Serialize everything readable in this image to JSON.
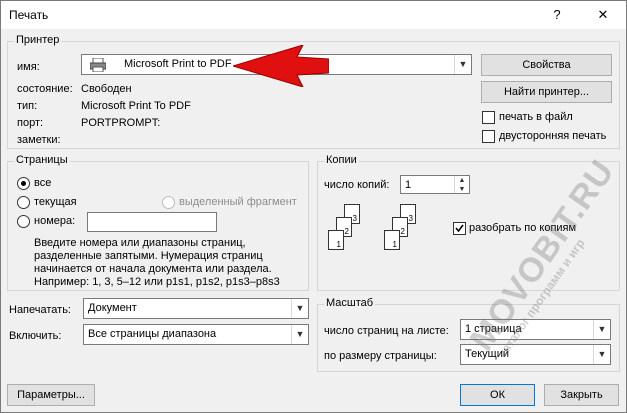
{
  "window": {
    "title": "Печать",
    "help_glyph": "?",
    "close_glyph": "✕"
  },
  "printer": {
    "legend": "Принтер",
    "name_label": "имя:",
    "name_value": "Microsoft Print to PDF",
    "status_label": "состояние:",
    "status_value": "Свободен",
    "type_label": "тип:",
    "type_value": "Microsoft Print To PDF",
    "port_label": "порт:",
    "port_value": "PORTPROMPT:",
    "notes_label": "заметки:",
    "properties_button": "Свойства",
    "find_button": "Найти принтер...",
    "print_to_file": "печать в файл",
    "duplex": "двусторонняя печать"
  },
  "pages": {
    "legend": "Страницы",
    "all": "все",
    "current": "текущая",
    "selection": "выделенный фрагмент",
    "numbers": "номера:",
    "numbers_value": "",
    "hint": [
      "Введите номера или диапазоны страниц,",
      "разделенные запятыми. Нумерация страниц",
      "начинается от начала документа или раздела.",
      "Например: 1, 3, 5–12 или p1s1, p1s2, p1s3–p8s3"
    ]
  },
  "copies": {
    "legend": "Копии",
    "count_label": "число копий:",
    "count_value": "1",
    "collate": "разобрать по копиям",
    "collate_checked": true,
    "stack_numbers": [
      "3",
      "2",
      "1"
    ]
  },
  "print_what": {
    "label": "Напечатать:",
    "value": "Документ"
  },
  "include": {
    "label": "Включить:",
    "value": "Все страницы диапазона"
  },
  "scale": {
    "legend": "Масштаб",
    "pages_per_sheet_label": "число страниц на листе:",
    "pages_per_sheet_value": "1 страница",
    "fit_label": "по размеру страницы:",
    "fit_value": "Текущий"
  },
  "footer": {
    "options_button": "Параметры...",
    "ok_button": "ОК",
    "close_button": "Закрыть"
  },
  "watermark": {
    "main": "MOVOBIT.RU",
    "sub": "каталог программ и игр"
  },
  "colors": {
    "arrow": "#e01010",
    "accent": "#0078d7"
  }
}
